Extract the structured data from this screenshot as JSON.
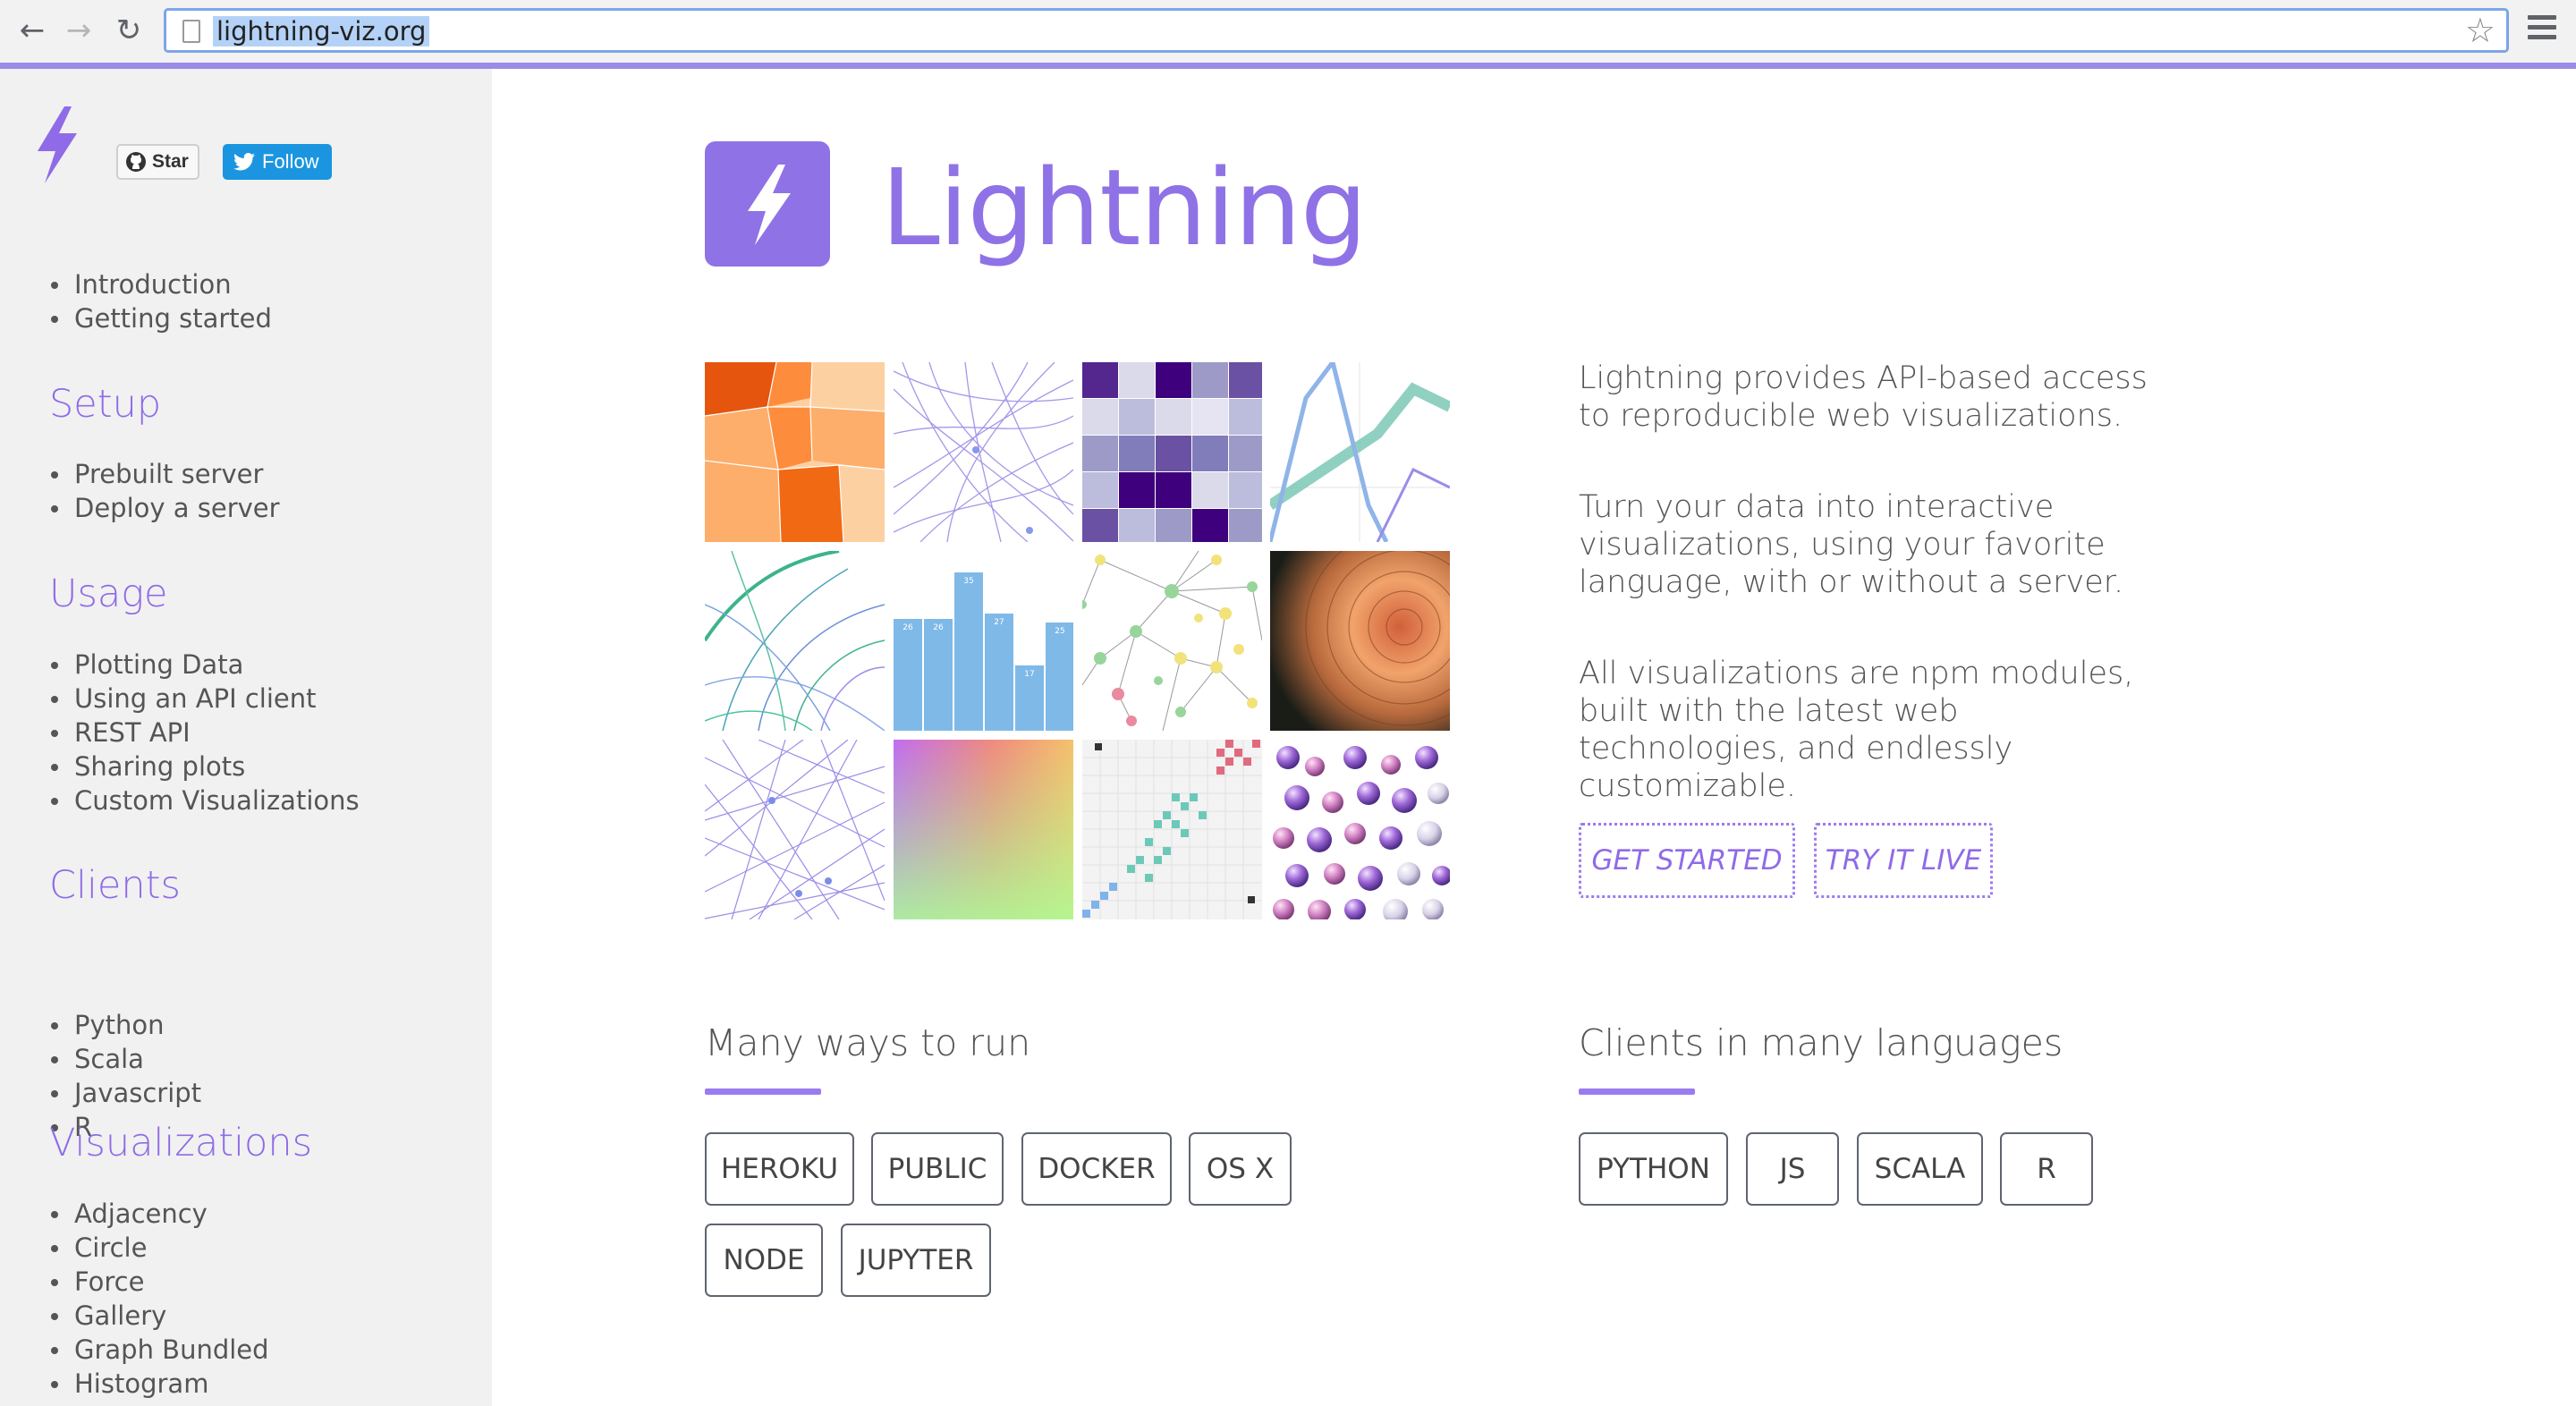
{
  "browser": {
    "url": "lightning-viz.org",
    "nav": {
      "back": "←",
      "forward": "→",
      "reload": "↻"
    },
    "star_glyph": "☆"
  },
  "sidebar": {
    "github_button": "Star",
    "twitter_button": "Follow",
    "top_links": [
      "Introduction",
      "Getting started"
    ],
    "sections": [
      {
        "title": "Setup",
        "items": [
          "Prebuilt server",
          "Deploy a server"
        ]
      },
      {
        "title": "Usage",
        "items": [
          "Plotting Data",
          "Using an API client",
          "REST API",
          "Sharing plots",
          "Custom Visualizations"
        ]
      },
      {
        "title": "Clients",
        "items": [
          "Python",
          "Scala",
          "Javascript",
          "R"
        ]
      },
      {
        "title": "Visualizations",
        "items": [
          "Adjacency",
          "Circle",
          "Force",
          "Gallery",
          "Graph Bundled",
          "Histogram"
        ]
      }
    ]
  },
  "main": {
    "title": "Lightning",
    "description": [
      "Lightning provides API-based access to reproducible web visualizations.",
      "Turn your data into interactive visualizations, using your favorite language, with or without a server.",
      "All visualizations are npm modules, built with the latest web technologies, and endlessly customizable."
    ],
    "cta": {
      "get_started": "GET STARTED",
      "try_live": "TRY IT LIVE"
    },
    "run": {
      "title": "Many ways to run",
      "options": [
        "HEROKU",
        "PUBLIC",
        "DOCKER",
        "OS X",
        "NODE",
        "JUPYTER"
      ]
    },
    "clients": {
      "title": "Clients in many languages",
      "options": [
        "PYTHON",
        "JS",
        "SCALA",
        "R"
      ]
    },
    "histogram_labels": [
      "26",
      "26",
      "35",
      "27",
      "17",
      "25"
    ]
  },
  "colors": {
    "accent": "#8f72e6",
    "sidebar_bg": "#f1f1f1",
    "url_highlight": "#b4d2f7"
  }
}
